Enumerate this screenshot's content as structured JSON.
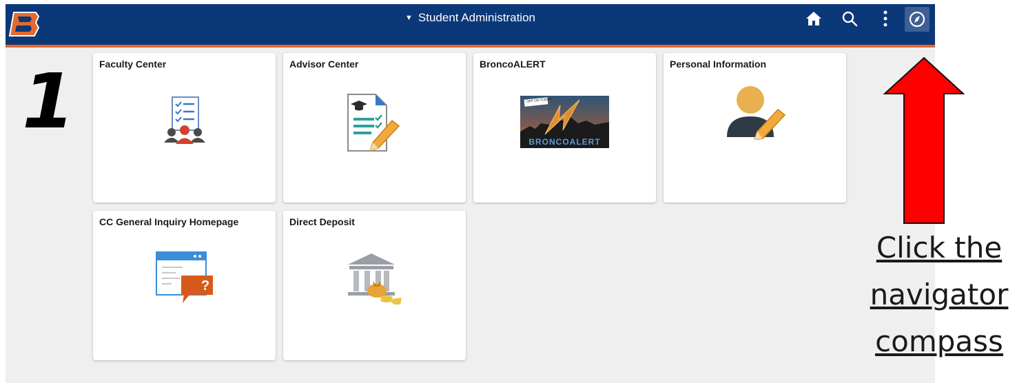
{
  "header": {
    "title": "Student Administration",
    "title_caret": "▼"
  },
  "tiles": [
    {
      "label": "Faculty Center"
    },
    {
      "label": "Advisor Center"
    },
    {
      "label": "BroncoALERT",
      "image_caption": "BRONCOALERT",
      "image_sign": "OFF ON TODAY!"
    },
    {
      "label": "Personal Information"
    },
    {
      "label": "CC General Inquiry Homepage",
      "bubble_text": "?"
    },
    {
      "label": "Direct Deposit"
    }
  ],
  "annotation": {
    "step_number": "1",
    "lines": [
      "Click the",
      "navigator",
      "compass"
    ]
  },
  "colors": {
    "header_bg": "#0b3878",
    "header_accent": "#e46a2e",
    "page_bg": "#efefef",
    "arrow": "#ff0000"
  }
}
